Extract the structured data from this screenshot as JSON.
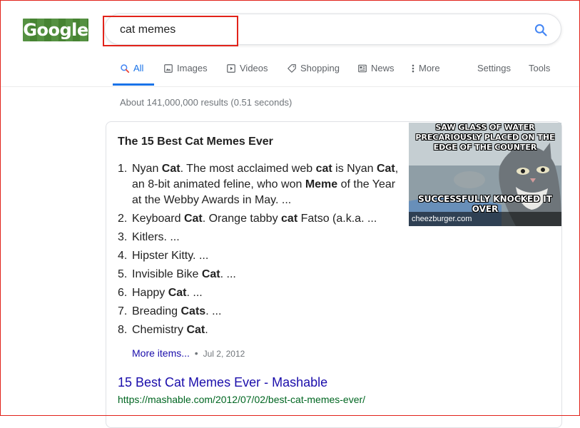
{
  "logo": {
    "text": "Google"
  },
  "search": {
    "query": "cat memes"
  },
  "tabs": [
    {
      "label": "All",
      "icon": "search-icon",
      "active": true
    },
    {
      "label": "Images",
      "icon": "image-icon"
    },
    {
      "label": "Videos",
      "icon": "play-icon"
    },
    {
      "label": "Shopping",
      "icon": "tag-icon"
    },
    {
      "label": "News",
      "icon": "newspaper-icon"
    },
    {
      "label": "More",
      "icon": "more-vert-icon"
    }
  ],
  "tools": {
    "settings": "Settings",
    "tools": "Tools"
  },
  "stats": "About 141,000,000 results (0.51 seconds)",
  "snippet": {
    "title": "The 15 Best Cat Memes Ever",
    "items": [
      {
        "num": "1.",
        "parts": [
          [
            "Nyan ",
            false
          ],
          [
            "Cat",
            true
          ],
          [
            ". The most acclaimed web ",
            false
          ],
          [
            "cat",
            true
          ],
          [
            " is Nyan ",
            false
          ],
          [
            "Cat",
            true
          ],
          [
            ", an 8-bit animated feline, who won ",
            false
          ],
          [
            "Meme",
            true
          ],
          [
            " of the Year at the Webby Awards in May. ...",
            false
          ]
        ]
      },
      {
        "num": "2.",
        "parts": [
          [
            "Keyboard ",
            false
          ],
          [
            "Cat",
            true
          ],
          [
            ". Orange tabby ",
            false
          ],
          [
            "cat",
            true
          ],
          [
            " Fatso (a.k.a. ...",
            false
          ]
        ]
      },
      {
        "num": "3.",
        "parts": [
          [
            "Kitlers. ...",
            false
          ]
        ]
      },
      {
        "num": "4.",
        "parts": [
          [
            "Hipster Kitty. ...",
            false
          ]
        ]
      },
      {
        "num": "5.",
        "parts": [
          [
            "Invisible Bike ",
            false
          ],
          [
            "Cat",
            true
          ],
          [
            ". ...",
            false
          ]
        ]
      },
      {
        "num": "6.",
        "parts": [
          [
            "Happy ",
            false
          ],
          [
            "Cat",
            true
          ],
          [
            ". ...",
            false
          ]
        ]
      },
      {
        "num": "7.",
        "parts": [
          [
            "Breading ",
            false
          ],
          [
            "Cats",
            true
          ],
          [
            ". ...",
            false
          ]
        ]
      },
      {
        "num": "8.",
        "parts": [
          [
            "Chemistry ",
            false
          ],
          [
            "Cat",
            true
          ],
          [
            ".",
            false
          ]
        ]
      }
    ],
    "more_items": "More items...",
    "date": "Jul 2, 2012",
    "image": {
      "caption_top": "Saw glass of water precariously placed on the edge of the counter",
      "caption_bottom": "Successfully knocked it over",
      "source": "cheezburger.com"
    }
  },
  "result": {
    "title": "15 Best Cat Memes Ever - Mashable",
    "url": "https://mashable.com/2012/07/02/best-cat-memes-ever/"
  },
  "colors": {
    "link": "#1a0dab",
    "url": "#006621",
    "accent": "#1a73e8",
    "highlight": "#e2231a"
  }
}
